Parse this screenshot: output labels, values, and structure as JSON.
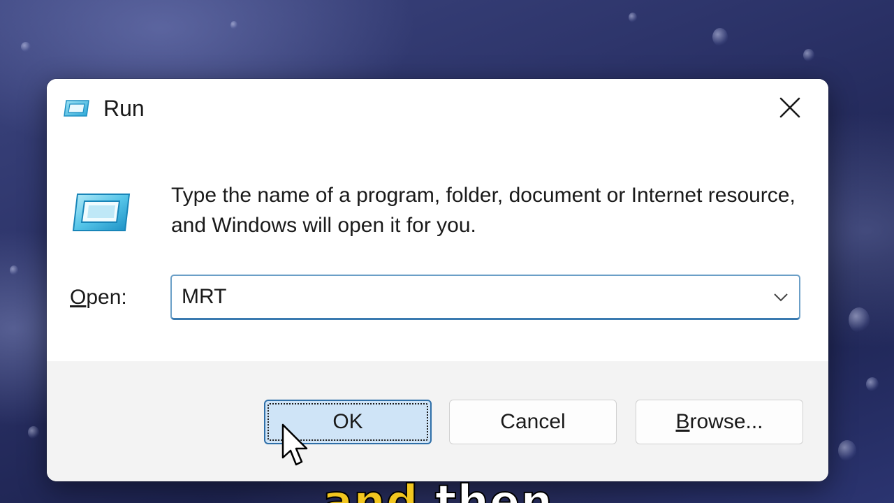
{
  "dialog": {
    "title": "Run",
    "close_icon": "close-icon",
    "app_icon": "run-icon"
  },
  "body": {
    "description": "Type the name of a program, folder, document or Internet resource, and Windows will open it for you.",
    "open_label_prefix": "O",
    "open_label_rest": "pen:",
    "open_value": "MRT",
    "dropdown_icon": "chevron-down-icon"
  },
  "buttons": {
    "ok": "OK",
    "cancel": "Cancel",
    "browse_prefix": "B",
    "browse_rest": "rowse..."
  },
  "caption": {
    "word1": "and",
    "word2": "then"
  },
  "colors": {
    "accent": "#2f6fa8",
    "ok_fill": "#cfe4f7",
    "caption_highlight": "#f2c61f"
  }
}
